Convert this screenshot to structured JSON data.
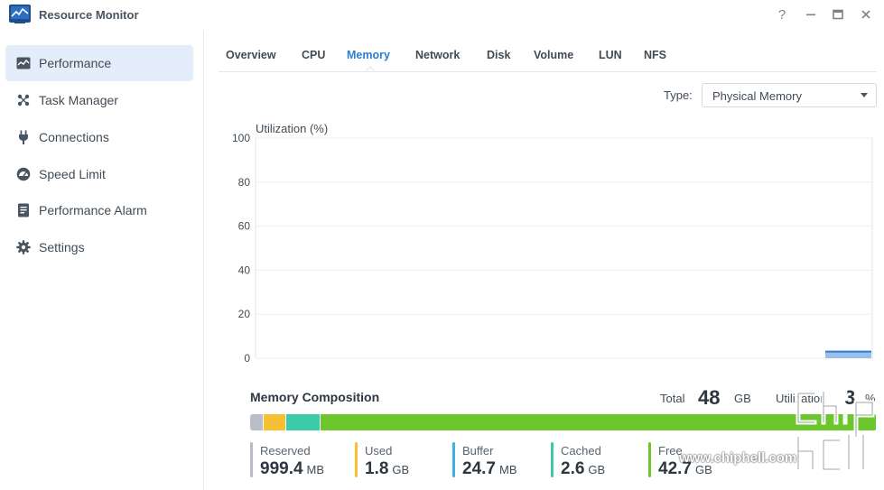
{
  "window": {
    "title": "Resource Monitor",
    "buttons": {
      "help": "?"
    }
  },
  "sidebar": {
    "items": [
      {
        "label": "Performance",
        "icon": "performance-icon",
        "active": true
      },
      {
        "label": "Task Manager",
        "icon": "task-manager-icon",
        "active": false
      },
      {
        "label": "Connections",
        "icon": "plug-icon",
        "active": false
      },
      {
        "label": "Speed Limit",
        "icon": "gauge-icon",
        "active": false
      },
      {
        "label": "Performance Alarm",
        "icon": "alarm-report-icon",
        "active": false
      },
      {
        "label": "Settings",
        "icon": "gear-icon",
        "active": false
      }
    ]
  },
  "tabs": [
    {
      "label": "Overview",
      "active": false
    },
    {
      "label": "CPU",
      "active": false
    },
    {
      "label": "Memory",
      "active": true
    },
    {
      "label": "Network",
      "active": false
    },
    {
      "label": "Disk",
      "active": false
    },
    {
      "label": "Volume",
      "active": false
    },
    {
      "label": "LUN",
      "active": false
    },
    {
      "label": "NFS",
      "active": false
    }
  ],
  "type_selector": {
    "label": "Type:",
    "value": "Physical Memory"
  },
  "chart_data": {
    "type": "area",
    "ylabel": "Utilization (%)",
    "ylim": [
      0,
      100
    ],
    "yticks": [
      "100",
      "80",
      "60",
      "40",
      "20",
      "0"
    ],
    "grid": true,
    "series": [
      {
        "values": [
          3,
          3
        ],
        "color": "#8fb8ea"
      }
    ]
  },
  "composition": {
    "title": "Memory Composition",
    "total_label": "Total",
    "total_value": "48",
    "total_unit": "GB",
    "utilization_label": "Utilization",
    "utilization_value": "3",
    "utilization_unit": "%",
    "segments": [
      {
        "name": "Reserved",
        "value": "999.4",
        "unit": "MB",
        "share": 0.021,
        "color": "#b7bec7"
      },
      {
        "name": "Used",
        "value": "1.8",
        "unit": "GB",
        "share": 0.037,
        "color": "#f6bf34"
      },
      {
        "name": "Buffer",
        "value": "24.7",
        "unit": "MB",
        "share": 0.0,
        "color": "#3eb0e2"
      },
      {
        "name": "Cached",
        "value": "2.6",
        "unit": "GB",
        "share": 0.054,
        "color": "#3ccaa8"
      },
      {
        "name": "Free",
        "value": "42.7",
        "unit": "GB",
        "share": 0.888,
        "color": "#6cc72c"
      }
    ]
  },
  "watermark": {
    "text": "www.chiphell.com",
    "logo_text": "chip hell"
  }
}
